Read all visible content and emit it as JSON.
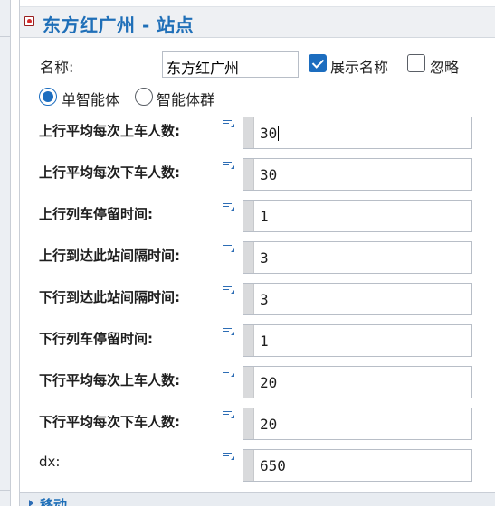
{
  "header": {
    "title": "东方红广州 - 站点",
    "icon": "node-icon"
  },
  "name_row": {
    "label": "名称:",
    "value": "东方红广州",
    "show_name": {
      "label": "展示名称",
      "checked": true
    },
    "ignore": {
      "label": "忽略",
      "checked": false
    }
  },
  "agent_type": {
    "options": [
      {
        "label": "单智能体",
        "selected": true
      },
      {
        "label": "智能体群",
        "selected": false
      }
    ]
  },
  "params": [
    {
      "label": "上行平均每次上车人数:",
      "value": "30",
      "bold": true
    },
    {
      "label": "上行平均每次下车人数:",
      "value": "30",
      "bold": true
    },
    {
      "label": "上行列车停留时间:",
      "value": "1",
      "bold": true
    },
    {
      "label": "上行到达此站间隔时间:",
      "value": "3",
      "bold": true
    },
    {
      "label": "下行到达此站间隔时间:",
      "value": "3",
      "bold": true
    },
    {
      "label": "下行列车停留时间:",
      "value": "1",
      "bold": true
    },
    {
      "label": "下行平均每次上车人数:",
      "value": "20",
      "bold": true
    },
    {
      "label": "下行平均每次下车人数:",
      "value": "20",
      "bold": true
    },
    {
      "label": "dx:",
      "value": "650",
      "bold": false
    }
  ],
  "footer": {
    "label": "移动"
  },
  "colors": {
    "accent": "#1c6dbf",
    "title": "#1f6fb8",
    "header_bg": "#eef0f3"
  }
}
